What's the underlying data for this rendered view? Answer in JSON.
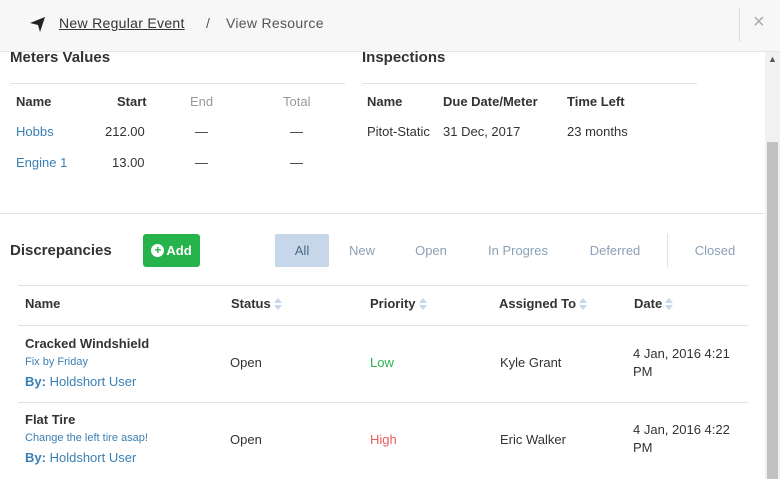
{
  "breadcrumb": {
    "parent": "New Regular Event",
    "separator": "/",
    "current": "View Resource"
  },
  "close_label": "×",
  "meters": {
    "title": "Meters Values",
    "headers": [
      "Name",
      "Start",
      "End",
      "Total"
    ],
    "rows": [
      {
        "name": "Hobbs",
        "start": "212.00",
        "end": "—",
        "total": "—"
      },
      {
        "name": "Engine 1",
        "start": "13.00",
        "end": "—",
        "total": "—"
      }
    ]
  },
  "inspections": {
    "title": "Inspections",
    "headers": [
      "Name",
      "Due Date/Meter",
      "Time Left"
    ],
    "rows": [
      {
        "name": "Pitot-Static",
        "due": "31 Dec, 2017",
        "left": "23 months"
      }
    ]
  },
  "discrepancies": {
    "title": "Discrepancies",
    "add_label": "Add",
    "filters": [
      "All",
      "New",
      "Open",
      "In Progres",
      "Deferred",
      "Closed"
    ],
    "active_filter": "All",
    "headers": [
      "Name",
      "Status",
      "Priority",
      "Assigned To",
      "Date"
    ],
    "rows": [
      {
        "name": "Cracked Windshield",
        "note": "Fix by Friday",
        "by_label": "By:",
        "by": "Holdshort User",
        "status": "Open",
        "priority": "Low",
        "assigned": "Kyle Grant",
        "date": "4 Jan, 2016 4:21 PM"
      },
      {
        "name": "Flat Tire",
        "note": "Change the left tire asap!",
        "by_label": "By:",
        "by": "Holdshort User",
        "status": "Open",
        "priority": "High",
        "assigned": "Eric Walker",
        "date": "4 Jan, 2016 4:22 PM"
      }
    ]
  },
  "colors": {
    "accent": "#26b34b",
    "link": "#3a7fb3",
    "high": "#e85d5d",
    "filter_active": "#c6d7e9"
  }
}
